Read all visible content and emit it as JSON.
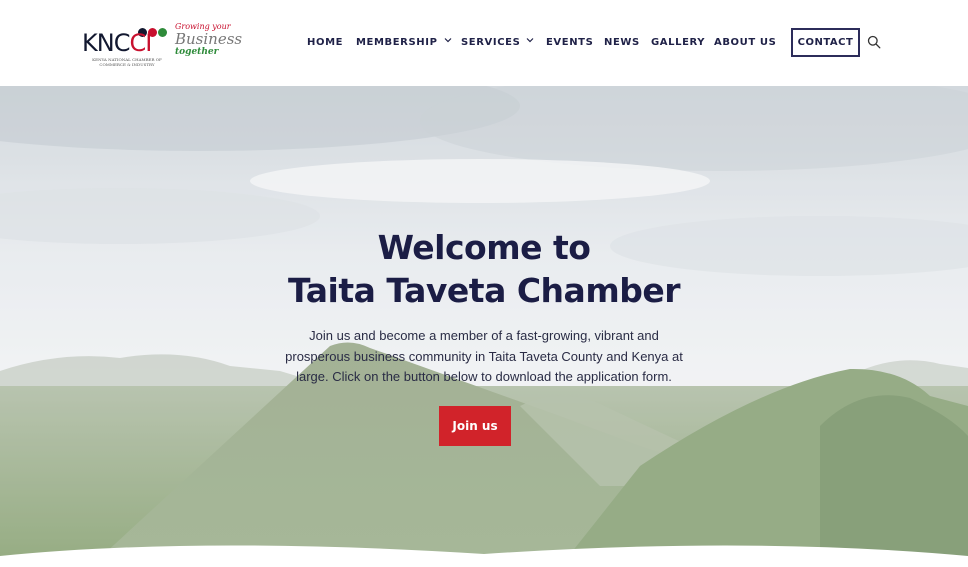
{
  "logo": {
    "word_kn": "KNC",
    "word_ci": "CI",
    "subtext": "KENYA NATIONAL CHAMBER OF COMMERCE & INDUSTRY",
    "tagline_1": "Growing your",
    "tagline_2": "Business",
    "tagline_3": "together",
    "dot_colors": [
      "#121830",
      "#c8102e",
      "#2e8b3a"
    ]
  },
  "nav": {
    "items": [
      {
        "label": "HOME",
        "has_dropdown": false
      },
      {
        "label": "MEMBERSHIP",
        "has_dropdown": true
      },
      {
        "label": "SERVICES",
        "has_dropdown": true
      },
      {
        "label": "EVENTS",
        "has_dropdown": false
      },
      {
        "label": "NEWS",
        "has_dropdown": false
      },
      {
        "label": "GALLERY",
        "has_dropdown": false
      },
      {
        "label": "ABOUT US",
        "has_dropdown": false
      }
    ],
    "contact_label": "CONTACT",
    "search_icon": "search-icon"
  },
  "hero": {
    "title_line1": "Welcome to",
    "title_line2": "Taita Taveta Chamber",
    "description": "Join us and become a member of a fast-growing, vibrant and prosperous business community in Taita Taveta County and Kenya at large. Click on the button below to download the application form.",
    "cta_label": "Join us"
  },
  "colors": {
    "primary_text": "#1b1d45",
    "cta": "#d1232a",
    "brand_red": "#c8102e",
    "brand_green": "#2e8b3a"
  }
}
